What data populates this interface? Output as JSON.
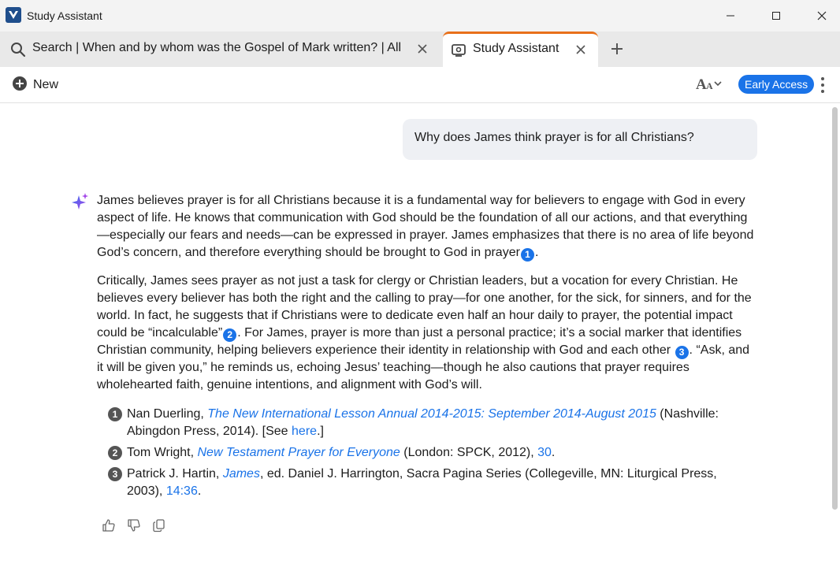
{
  "window": {
    "title": "Study Assistant"
  },
  "tabs": [
    {
      "label": "Search | When and by whom was the Gospel of Mark written? | All",
      "icon": "search-icon",
      "active": false
    },
    {
      "label": "Study Assistant",
      "icon": "study-assistant-icon",
      "active": true
    }
  ],
  "toolbar": {
    "new_label": "New",
    "early_access": "Early Access"
  },
  "colors": {
    "accent": "#1a73e8",
    "active_tab_border": "#e8701a",
    "brand": "#1f4e8c"
  },
  "chat": {
    "question": "Why does James think prayer is for all Christians?",
    "answer": {
      "p1": {
        "text": "James believes prayer is for all Christians because it is a fundamental way for believers to engage with God in every aspect of life. He knows that communication with God should be the foundation of all our actions, and that everything—especially our fears and needs—can be expressed in prayer. James emphasizes that there is no area of life beyond God’s concern, and therefore everything should be brought to God in prayer",
        "cite": "1",
        "end": "."
      },
      "p2": {
        "a": "Critically, James sees prayer as not just a task for clergy or Christian leaders, but a vocation for every Christian. He believes every believer has both the right and the calling to pray—for one another, for the sick, for sinners, and for the world. In fact, he suggests that if Christians were to dedicate even half an hour daily to prayer, the potential impact could be “incalculable”",
        "cite_a": "2",
        "b": ". For James, prayer is more than just a personal practice; it’s a social marker that identifies Christian community, helping believers experience their identity in relationship with God and each other ",
        "cite_b": "3",
        "c": ". “Ask, and it will be given you,” he reminds us, echoing Jesus’ teaching—though he also cautions that prayer requires wholehearted faith, genuine intentions, and alignment with God’s will."
      }
    },
    "references": [
      {
        "num": "1",
        "author": "Nan Duerling, ",
        "title": "The New International Lesson Annual 2014-2015: September 2014-August 2015",
        "pub": " (Nashville: Abingdon Press, 2014). [See ",
        "link": "here",
        "tail": ".]"
      },
      {
        "num": "2",
        "author": "Tom Wright, ",
        "title": "New Testament Prayer for Everyone",
        "pub": " (London: SPCK, 2012), ",
        "link": "30",
        "tail": "."
      },
      {
        "num": "3",
        "author": "Patrick J. Hartin, ",
        "title": "James",
        "pub": ", ed. Daniel J. Harrington, Sacra Pagina Series (Collegeville, MN: Liturgical Press, 2003), ",
        "link": "14:36",
        "tail": "."
      }
    ]
  },
  "feedback": [
    "thumbs-up-icon",
    "thumbs-down-icon",
    "copy-icon"
  ]
}
